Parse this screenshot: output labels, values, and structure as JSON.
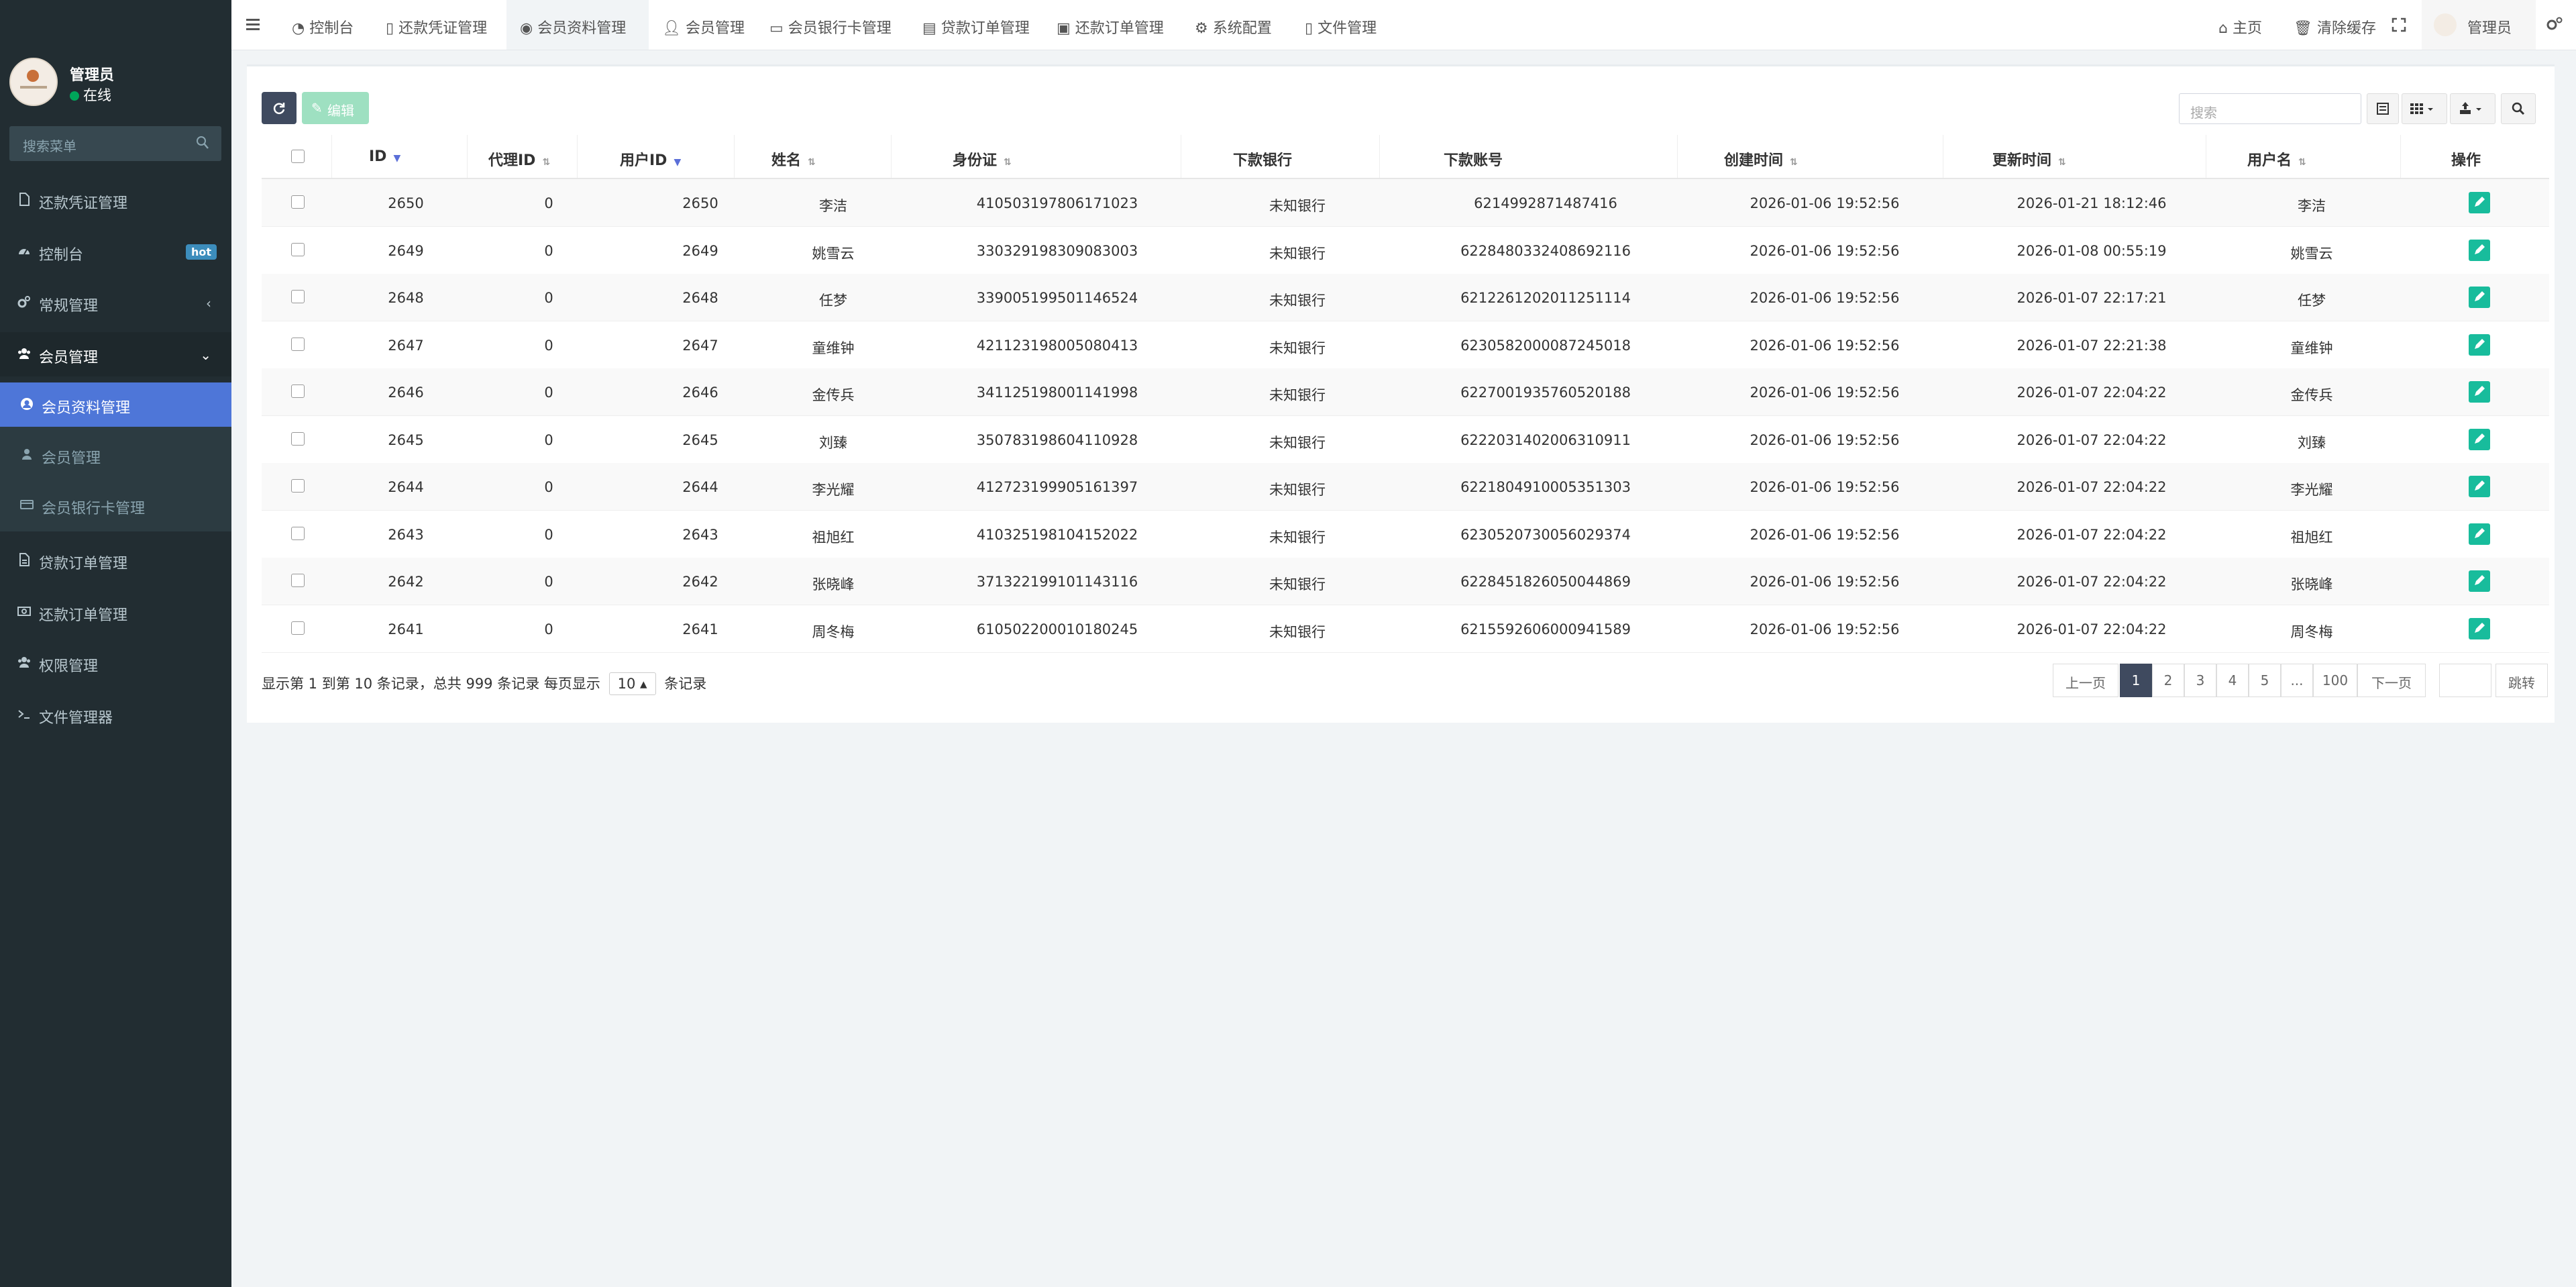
{
  "sidebar": {
    "user": {
      "name": "管理员",
      "status": "在线"
    },
    "search_placeholder": "搜索菜单",
    "items": [
      {
        "label": "还款凭证管理",
        "icon": "file-icon"
      },
      {
        "label": "控制台",
        "icon": "dashboard-icon",
        "badge": "hot"
      },
      {
        "label": "常规管理",
        "icon": "cogs-icon"
      },
      {
        "label": "会员管理",
        "icon": "users-icon"
      },
      {
        "label": "会员资料管理",
        "icon": "user-circle-icon"
      },
      {
        "label": "会员管理",
        "icon": "user-icon"
      },
      {
        "label": "会员银行卡管理",
        "icon": "credit-card-icon"
      },
      {
        "label": "贷款订单管理",
        "icon": "file-text-icon"
      },
      {
        "label": "还款订单管理",
        "icon": "money-icon"
      },
      {
        "label": "权限管理",
        "icon": "group-icon"
      },
      {
        "label": "文件管理器",
        "icon": "terminal-icon"
      }
    ]
  },
  "topbar": {
    "tabs": [
      {
        "label": "控制台"
      },
      {
        "label": "还款凭证管理"
      },
      {
        "label": "会员资料管理"
      },
      {
        "label": "会员管理"
      },
      {
        "label": "会员银行卡管理"
      },
      {
        "label": "贷款订单管理"
      },
      {
        "label": "还款订单管理"
      },
      {
        "label": "系统配置"
      },
      {
        "label": "文件管理"
      }
    ],
    "home": "主页",
    "clear_cache": "清除缓存",
    "admin": "管理员"
  },
  "toolbar": {
    "edit_label": "编辑",
    "search_placeholder": "搜索"
  },
  "table": {
    "headers": [
      "ID",
      "代理ID",
      "用户ID",
      "姓名",
      "身份证",
      "下款银行",
      "下款账号",
      "创建时间",
      "更新时间",
      "用户名",
      "操作"
    ],
    "rows": [
      [
        "2650",
        "0",
        "2650",
        "李洁",
        "410503197806171023",
        "未知银行",
        "6214992871487416",
        "2026-01-06 19:52:56",
        "2026-01-21 18:12:46",
        "李洁"
      ],
      [
        "2649",
        "0",
        "2649",
        "姚雪云",
        "330329198309083003",
        "未知银行",
        "6228480332408692116",
        "2026-01-06 19:52:56",
        "2026-01-08 00:55:19",
        "姚雪云"
      ],
      [
        "2648",
        "0",
        "2648",
        "任梦",
        "339005199501146524",
        "未知银行",
        "6212261202011251114",
        "2026-01-06 19:52:56",
        "2026-01-07 22:17:21",
        "任梦"
      ],
      [
        "2647",
        "0",
        "2647",
        "童维钟",
        "421123198005080413",
        "未知银行",
        "6230582000087245018",
        "2026-01-06 19:52:56",
        "2026-01-07 22:21:38",
        "童维钟"
      ],
      [
        "2646",
        "0",
        "2646",
        "金传兵",
        "341125198001141998",
        "未知银行",
        "6227001935760520188",
        "2026-01-06 19:52:56",
        "2026-01-07 22:04:22",
        "金传兵"
      ],
      [
        "2645",
        "0",
        "2645",
        "刘臻",
        "350783198604110928",
        "未知银行",
        "6222031402006310911",
        "2026-01-06 19:52:56",
        "2026-01-07 22:04:22",
        "刘臻"
      ],
      [
        "2644",
        "0",
        "2644",
        "李光耀",
        "412723199905161397",
        "未知银行",
        "6221804910005351303",
        "2026-01-06 19:52:56",
        "2026-01-07 22:04:22",
        "李光耀"
      ],
      [
        "2643",
        "0",
        "2643",
        "祖旭红",
        "410325198104152022",
        "未知银行",
        "6230520730056029374",
        "2026-01-06 19:52:56",
        "2026-01-07 22:04:22",
        "祖旭红"
      ],
      [
        "2642",
        "0",
        "2642",
        "张晓峰",
        "371322199101143116",
        "未知银行",
        "6228451826050044869",
        "2026-01-06 19:52:56",
        "2026-01-07 22:04:22",
        "张晓峰"
      ],
      [
        "2641",
        "0",
        "2641",
        "周冬梅",
        "610502200010180245",
        "未知银行",
        "6215592606000941589",
        "2026-01-06 19:52:56",
        "2026-01-07 22:04:22",
        "周冬梅"
      ]
    ]
  },
  "footer": {
    "info_prefix": "显示第 1 到第 10 条记录，总共 999 条记录 每页显示",
    "page_size": "10",
    "info_suffix": "条记录",
    "prev": "上一页",
    "pages": [
      "1",
      "2",
      "3",
      "4",
      "5",
      "...",
      "100"
    ],
    "next": "下一页",
    "jump": "跳转"
  }
}
